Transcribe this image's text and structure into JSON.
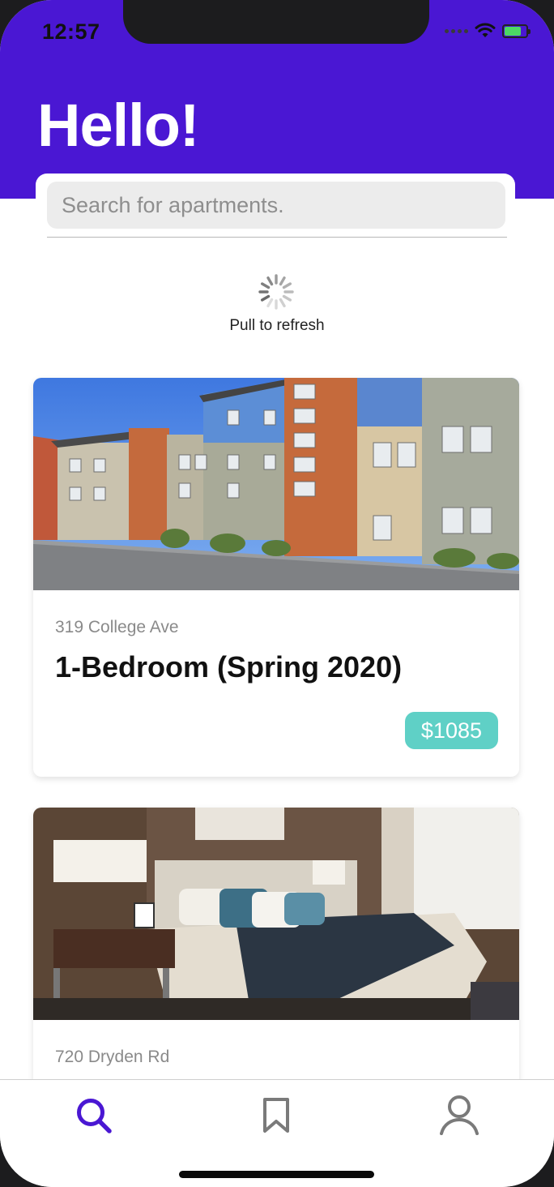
{
  "status_bar": {
    "time": "12:57"
  },
  "header": {
    "greeting": "Hello!"
  },
  "search": {
    "placeholder": "Search for apartments."
  },
  "refresh": {
    "label": "Pull to refresh"
  },
  "listings": [
    {
      "address": "319 College Ave",
      "title": "1-Bedroom (Spring 2020)",
      "price": "$1085"
    },
    {
      "address": "720 Dryden Rd"
    }
  ],
  "tabs": [
    {
      "icon": "search-icon",
      "active": true
    },
    {
      "icon": "bookmark-icon",
      "active": false
    },
    {
      "icon": "profile-icon",
      "active": false
    }
  ],
  "colors": {
    "brand_purple": "#4a17d3",
    "price_badge": "#5fd0c6",
    "inactive_tab": "#7a7a7a"
  }
}
